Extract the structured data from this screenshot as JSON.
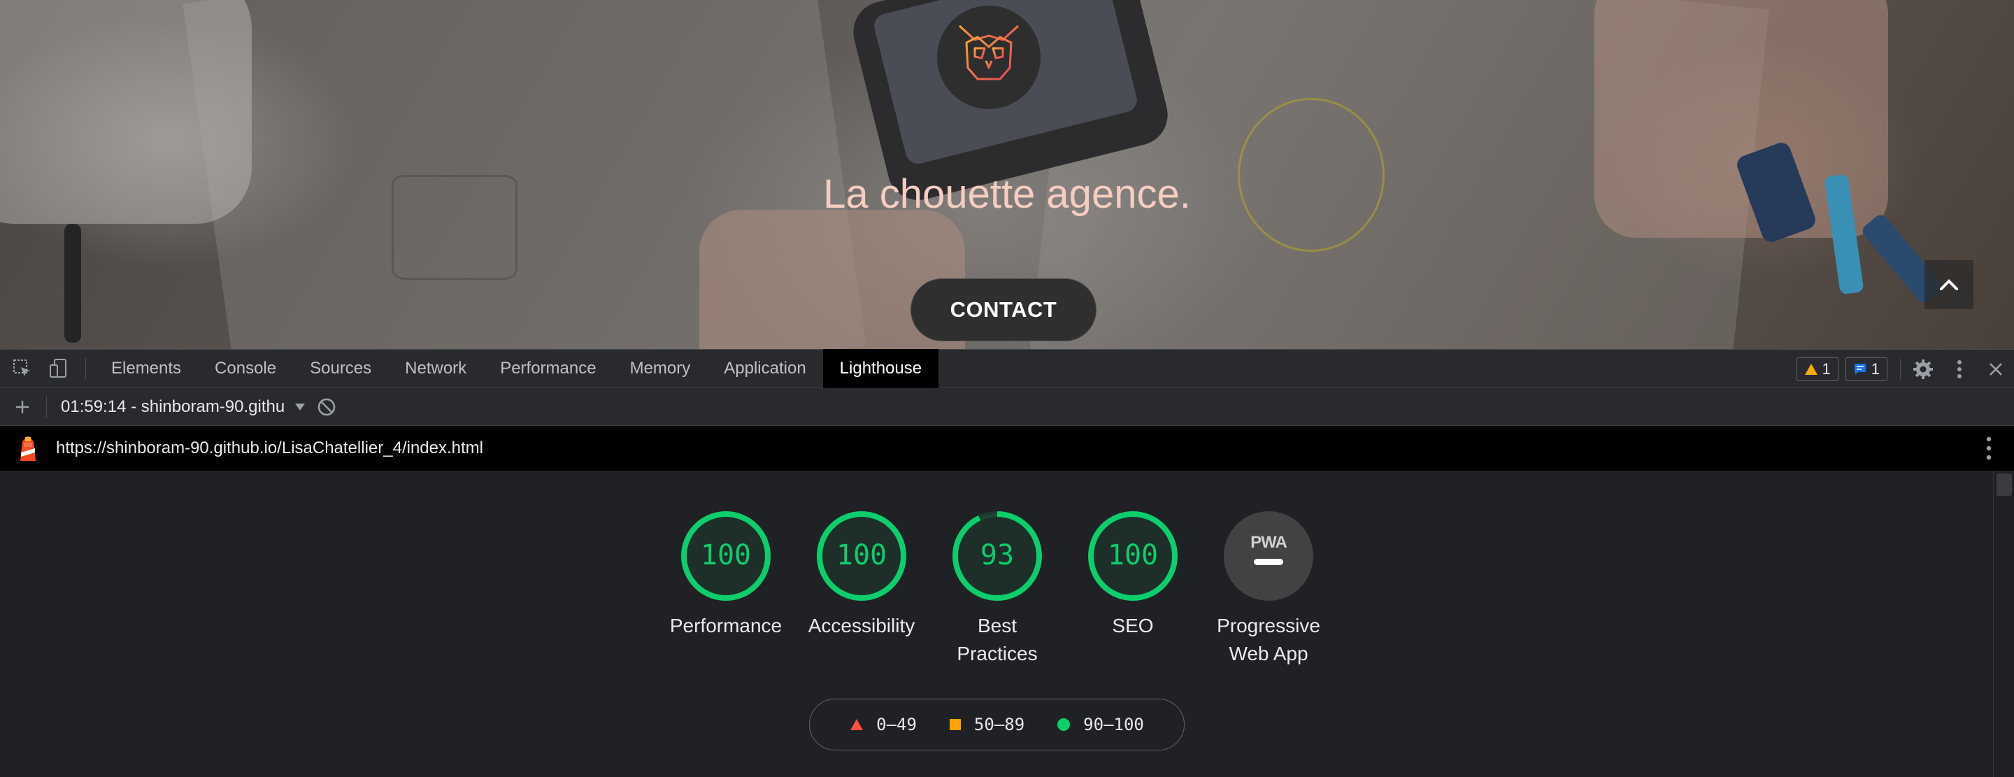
{
  "page": {
    "site_title": "La chouette agence.",
    "contact_label": "CONTACT"
  },
  "devtools": {
    "tabs": [
      {
        "label": "Elements"
      },
      {
        "label": "Console"
      },
      {
        "label": "Sources"
      },
      {
        "label": "Network"
      },
      {
        "label": "Performance"
      },
      {
        "label": "Memory"
      },
      {
        "label": "Application"
      },
      {
        "label": "Lighthouse",
        "active": true
      }
    ],
    "warnings_count": "1",
    "messages_count": "1",
    "icons": [
      "inspect-element-icon",
      "device-toggle-icon",
      "gear-icon",
      "kebab-menu-icon",
      "close-icon"
    ]
  },
  "lighthouse": {
    "report_label": "01:59:14 - shinboram-90.github.io",
    "url": "https://shinboram-90.github.io/LisaChatellier_4/index.html",
    "gauges": [
      {
        "label_lines": [
          "Performance"
        ],
        "score": 100
      },
      {
        "label_lines": [
          "Accessibility"
        ],
        "score": 100
      },
      {
        "label_lines": [
          "Best",
          "Practices"
        ],
        "score": 93
      },
      {
        "label_lines": [
          "SEO"
        ],
        "score": 100
      }
    ],
    "pwa": {
      "badge_text": "PWA",
      "label_lines": [
        "Progressive",
        "Web App"
      ]
    },
    "legend": [
      {
        "shape": "triangle",
        "range": "0–49",
        "color": "#ff4e42"
      },
      {
        "shape": "square",
        "range": "50–89",
        "color": "#ffa400"
      },
      {
        "shape": "circle",
        "range": "90–100",
        "color": "#0cce6b"
      }
    ],
    "colors": {
      "pass": "#0cce6b",
      "gauge_fill": "rgba(12,206,107,0.08)",
      "track": "rgba(12,206,107,0.15)"
    }
  }
}
